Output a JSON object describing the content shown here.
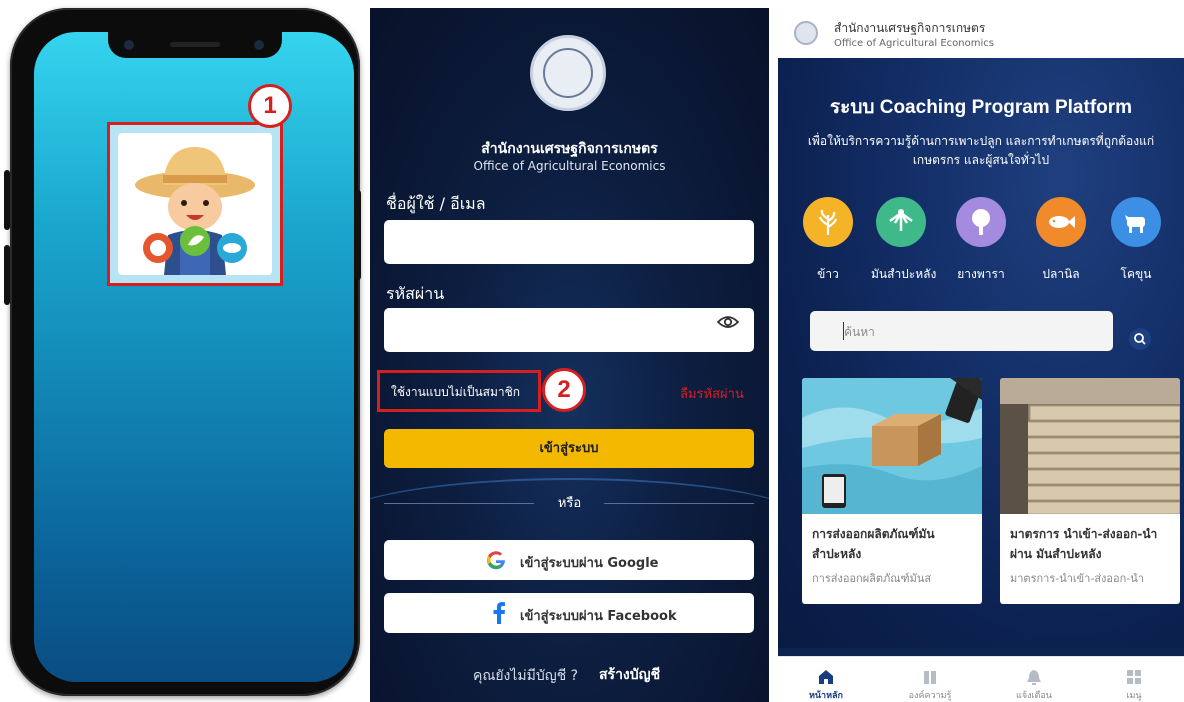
{
  "steps": {
    "step1": "1",
    "step2": "2"
  },
  "login": {
    "org_th": "สำนักงานเศรษฐกิจการเกษตร",
    "org_en": "Office of Agricultural Economics",
    "username_label": "ชื่อผู้ใช้ / อีเมล",
    "password_label": "รหัสผ่าน",
    "guest_label": "ใช้งานแบบไม่เป็นสมาชิก",
    "forgot_label": "ลืมรหัสผ่าน",
    "login_button": "เข้าสู่ระบบ",
    "or_label": "หรือ",
    "google_button": "เข้าสู่ระบบผ่าน Google",
    "facebook_button": "เข้าสู่ระบบผ่าน Facebook",
    "signup_question": "คุณยังไม่มีบัญชี ?",
    "signup_link": "สร้างบัญชี"
  },
  "home": {
    "header_org_th": "สำนักงานเศรษฐกิจการเกษตร",
    "header_org_en": "Office of Agricultural Economics",
    "hero_title": "ระบบ Coaching Program Platform",
    "hero_sub_line1": "เพื่อให้บริการความรู้ด้านการเพาะปลูก และการทำเกษตรที่ถูกต้องแก่",
    "hero_sub_line2": "เกษตรกร และผู้สนใจทั่วไป",
    "categories": [
      {
        "label": "ข้าว",
        "color": "#f5b428",
        "icon": "rice-icon"
      },
      {
        "label": "มันสำปะหลัง",
        "color": "#3fb98a",
        "icon": "cassava-icon"
      },
      {
        "label": "ยางพารา",
        "color": "#a58be0",
        "icon": "rubber-tree-icon"
      },
      {
        "label": "ปลานิล",
        "color": "#f08a2a",
        "icon": "fish-icon"
      },
      {
        "label": "โคขุน",
        "color": "#3d8fe6",
        "icon": "cow-icon"
      }
    ],
    "search_placeholder": "ค้นหา",
    "cards": [
      {
        "title": "การส่งออกผลิตภัณฑ์มันสำปะหลัง",
        "subtitle": "การส่งออกผลิตภัณฑ์มันส"
      },
      {
        "title": "มาตรการ นำเข้า-ส่งออก-นำผ่าน มันสำปะหลัง",
        "subtitle": "มาตรการ-นำเข้า-ส่งออก-นำ"
      }
    ],
    "nav": [
      {
        "label": "หน้าหลัก",
        "icon": "home-icon"
      },
      {
        "label": "องค์ความรู้",
        "icon": "book-icon"
      },
      {
        "label": "แจ้งเตือน",
        "icon": "bell-icon"
      },
      {
        "label": "เมนู",
        "icon": "grid-icon"
      }
    ]
  },
  "colors": {
    "highlight_red": "#d62020",
    "login_yellow": "#f5b800",
    "navy": "#0d2350"
  }
}
